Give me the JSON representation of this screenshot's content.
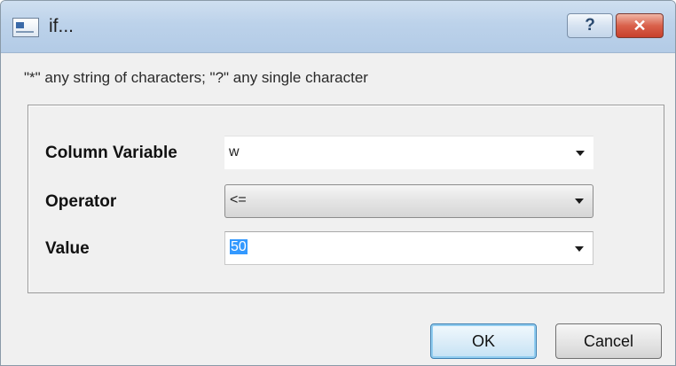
{
  "window": {
    "title": "if...",
    "help_label": "?",
    "close_label": "✕"
  },
  "hint": "\"*\" any string of characters; \"?\" any single character",
  "form": {
    "column_variable": {
      "label": "Column Variable",
      "value": "w"
    },
    "operator": {
      "label": "Operator",
      "value": "<="
    },
    "value": {
      "label": "Value",
      "value": "50"
    }
  },
  "buttons": {
    "ok": "OK",
    "cancel": "Cancel"
  }
}
